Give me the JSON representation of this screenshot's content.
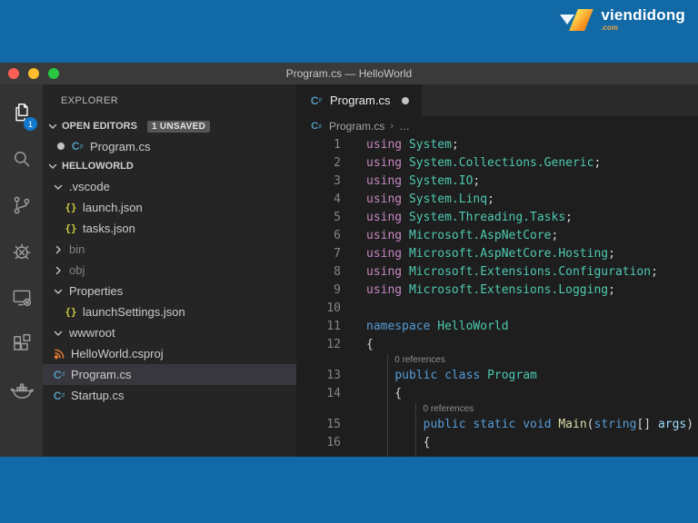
{
  "brand": {
    "name": "viendidong",
    "tld": ".com"
  },
  "window": {
    "title": "Program.cs — HelloWorld"
  },
  "titlebar_controls": [
    "close",
    "minimize",
    "zoom"
  ],
  "activity_bar": {
    "items": [
      {
        "name": "explorer",
        "icon": "files-icon",
        "active": true,
        "badge": "1"
      },
      {
        "name": "search",
        "icon": "search-icon"
      },
      {
        "name": "source-control",
        "icon": "source-control-icon"
      },
      {
        "name": "debug",
        "icon": "bug-icon"
      },
      {
        "name": "remote-explorer",
        "icon": "remote-explorer-icon"
      },
      {
        "name": "extensions",
        "icon": "extensions-icon"
      },
      {
        "name": "docker",
        "icon": "docker-whale-icon"
      }
    ]
  },
  "sidebar": {
    "header": "EXPLORER",
    "open_editors": {
      "label": "OPEN EDITORS",
      "badge": "1 UNSAVED",
      "items": [
        {
          "label": "Program.cs",
          "kind": "csharp",
          "modified": true
        }
      ]
    },
    "project": {
      "label": "HELLOWORLD",
      "tree": [
        {
          "label": ".vscode",
          "kind": "folder",
          "state": "expanded",
          "indent": 0
        },
        {
          "label": "launch.json",
          "kind": "json",
          "indent": 1
        },
        {
          "label": "tasks.json",
          "kind": "json",
          "indent": 1
        },
        {
          "label": "bin",
          "kind": "folder",
          "state": "collapsed",
          "indent": 0,
          "dim": true
        },
        {
          "label": "obj",
          "kind": "folder",
          "state": "collapsed",
          "indent": 0,
          "dim": true
        },
        {
          "label": "Properties",
          "kind": "folder",
          "state": "expanded",
          "indent": 0
        },
        {
          "label": "launchSettings.json",
          "kind": "json",
          "indent": 1
        },
        {
          "label": "wwwroot",
          "kind": "folder",
          "state": "expanded",
          "indent": 0
        },
        {
          "label": "HelloWorld.csproj",
          "kind": "xml",
          "indent": 0
        },
        {
          "label": "Program.cs",
          "kind": "csharp",
          "indent": 0,
          "selected": true
        },
        {
          "label": "Startup.cs",
          "kind": "csharp",
          "indent": 0
        }
      ]
    }
  },
  "editor": {
    "tab": {
      "label": "Program.cs",
      "modified": true
    },
    "breadcrumb": {
      "file": "Program.cs",
      "separator": "›",
      "more": "…"
    },
    "lines": [
      {
        "n": 1,
        "tokens": [
          [
            "kwp",
            "using "
          ],
          [
            "ns",
            "System"
          ],
          [
            "pu",
            ";"
          ]
        ]
      },
      {
        "n": 2,
        "tokens": [
          [
            "kwp",
            "using "
          ],
          [
            "ns",
            "System.Collections.Generic"
          ],
          [
            "pu",
            ";"
          ]
        ]
      },
      {
        "n": 3,
        "tokens": [
          [
            "kwp",
            "using "
          ],
          [
            "ns",
            "System.IO"
          ],
          [
            "pu",
            ";"
          ]
        ]
      },
      {
        "n": 4,
        "tokens": [
          [
            "kwp",
            "using "
          ],
          [
            "ns",
            "System.Linq"
          ],
          [
            "pu",
            ";"
          ]
        ]
      },
      {
        "n": 5,
        "tokens": [
          [
            "kwp",
            "using "
          ],
          [
            "ns",
            "System.Threading.Tasks"
          ],
          [
            "pu",
            ";"
          ]
        ]
      },
      {
        "n": 6,
        "tokens": [
          [
            "kwp",
            "using "
          ],
          [
            "ns",
            "Microsoft.AspNetCore"
          ],
          [
            "pu",
            ";"
          ]
        ]
      },
      {
        "n": 7,
        "tokens": [
          [
            "kwp",
            "using "
          ],
          [
            "ns",
            "Microsoft.AspNetCore.Hosting"
          ],
          [
            "pu",
            ";"
          ]
        ]
      },
      {
        "n": 8,
        "tokens": [
          [
            "kwp",
            "using "
          ],
          [
            "ns",
            "Microsoft.Extensions.Configuration"
          ],
          [
            "pu",
            ";"
          ]
        ]
      },
      {
        "n": 9,
        "tokens": [
          [
            "kwp",
            "using "
          ],
          [
            "ns",
            "Microsoft.Extensions.Logging"
          ],
          [
            "pu",
            ";"
          ]
        ]
      },
      {
        "n": 10,
        "tokens": []
      },
      {
        "n": 11,
        "tokens": [
          [
            "kwb",
            "namespace "
          ],
          [
            "ns",
            "HelloWorld"
          ]
        ]
      },
      {
        "n": 12,
        "tokens": [
          [
            "pu",
            "{"
          ]
        ]
      },
      {
        "lens": "0 references",
        "indent": 4
      },
      {
        "n": 13,
        "tokens": [
          [
            "pu",
            "    "
          ],
          [
            "kwb",
            "public "
          ],
          [
            "kwb",
            "class "
          ],
          [
            "ns",
            "Program"
          ]
        ]
      },
      {
        "n": 14,
        "tokens": [
          [
            "pu",
            "    {"
          ]
        ]
      },
      {
        "lens": "0 references",
        "indent": 8
      },
      {
        "n": 15,
        "tokens": [
          [
            "pu",
            "        "
          ],
          [
            "kwb",
            "public "
          ],
          [
            "kwb",
            "static "
          ],
          [
            "kwb",
            "void "
          ],
          [
            "fn",
            "Main"
          ],
          [
            "pu",
            "("
          ],
          [
            "kwb",
            "string"
          ],
          [
            "pu",
            "[] "
          ],
          [
            "pr",
            "args"
          ],
          [
            "pu",
            ")"
          ]
        ]
      },
      {
        "n": 16,
        "tokens": [
          [
            "pu",
            "        {"
          ]
        ]
      }
    ]
  },
  "colors": {
    "frame_blue": "#1169a6",
    "badge_blue": "#1079ce",
    "titlebar": "#3a3a3a",
    "activity_bar": "#333333",
    "sidebar": "#252526",
    "editor": "#1e1e1e",
    "tab_strip": "#2a2a2b",
    "selection": "#37373d",
    "light_red": "#ff5f57",
    "light_yellow": "#febc2e",
    "light_green": "#28c840",
    "json_yellow": "#cbcb41",
    "csharp_blue": "#519aba",
    "xml_orange": "#e37933",
    "syn_kwp": "#c586c0",
    "syn_kwb": "#569cd6",
    "syn_ns": "#4ec9b0",
    "syn_fn": "#dcdcaa",
    "syn_pr": "#9cdcfe",
    "syn_pu": "#d4d4d4"
  }
}
